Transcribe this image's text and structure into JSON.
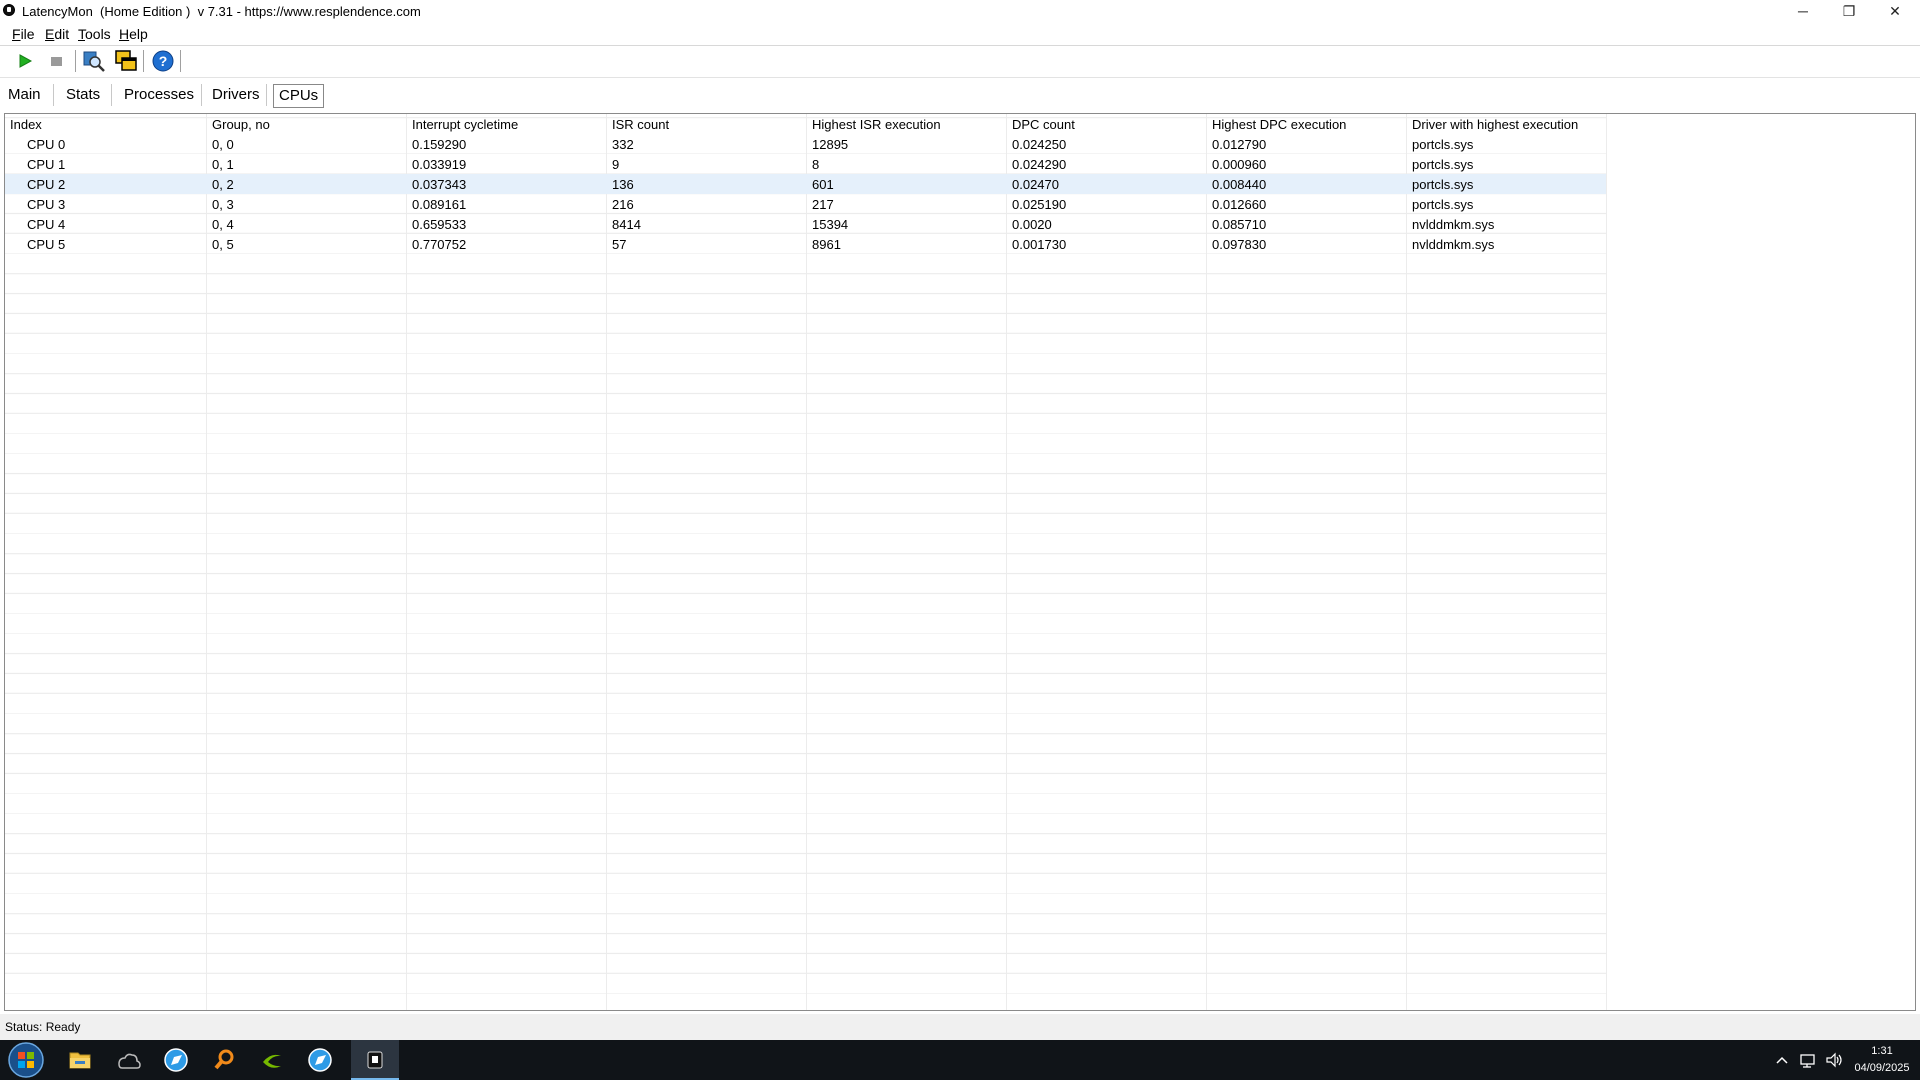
{
  "window": {
    "title": "LatencyMon  (Home Edition )  v 7.31 - https://www.resplendence.com",
    "minimize_glyph": "─",
    "maximize_glyph": "❐",
    "close_glyph": "✕"
  },
  "menu": {
    "file_u": "F",
    "file_rest": "ile",
    "edit_u": "E",
    "edit_rest": "dit",
    "tools_u": "T",
    "tools_rest": "ools",
    "help_u": "H",
    "help_rest": "elp"
  },
  "toolbar": {
    "icons": [
      "play-icon",
      "stop-icon",
      "analyze-icon",
      "windows-icon",
      "help-icon"
    ]
  },
  "tabs": [
    {
      "label": "Main",
      "active": false
    },
    {
      "label": "Stats",
      "active": false
    },
    {
      "label": "Processes",
      "active": false
    },
    {
      "label": "Drivers",
      "active": false
    },
    {
      "label": "CPUs",
      "active": true
    }
  ],
  "table": {
    "columns": [
      "Index",
      "Group, no",
      "Interrupt cycletime",
      "ISR count",
      "Highest ISR execution",
      "DPC count",
      "Highest DPC execution",
      "Driver with highest execution"
    ],
    "rows": [
      [
        "CPU 0",
        "0, 0",
        "0.159290",
        "332",
        "12895",
        "0.024250",
        "0.012790",
        "portcls.sys"
      ],
      [
        "CPU 1",
        "0, 1",
        "0.033919",
        "9",
        "8",
        "0.024290",
        "0.000960",
        "portcls.sys"
      ],
      [
        "CPU 2",
        "0, 2",
        "0.037343",
        "136",
        "601",
        "0.02470",
        "0.008440",
        "portcls.sys"
      ],
      [
        "CPU 3",
        "0, 3",
        "0.089161",
        "216",
        "217",
        "0.025190",
        "0.012660",
        "portcls.sys"
      ],
      [
        "CPU 4",
        "0, 4",
        "0.659533",
        "8414",
        "15394",
        "0.0020",
        "0.085710",
        "nvlddmkm.sys"
      ],
      [
        "CPU 5",
        "0, 5",
        "0.770752",
        "57",
        "8961",
        "0.001730",
        "0.097830",
        "nvlddmkm.sys"
      ]
    ],
    "selected_row": 2
  },
  "status": {
    "text": "Status: Ready"
  },
  "taskbar": {
    "icons": [
      "start-icon",
      "file-explorer-icon",
      "weather-icon",
      "browser-icon",
      "search-app-icon",
      "nvidia-icon",
      "browser-icon-2",
      "latencymon-icon"
    ],
    "time": "1:31",
    "date": "04/09/2025"
  },
  "colors": {
    "selected_row": "#e5f0fb",
    "taskbar": "#101418",
    "play": "#22b022"
  }
}
